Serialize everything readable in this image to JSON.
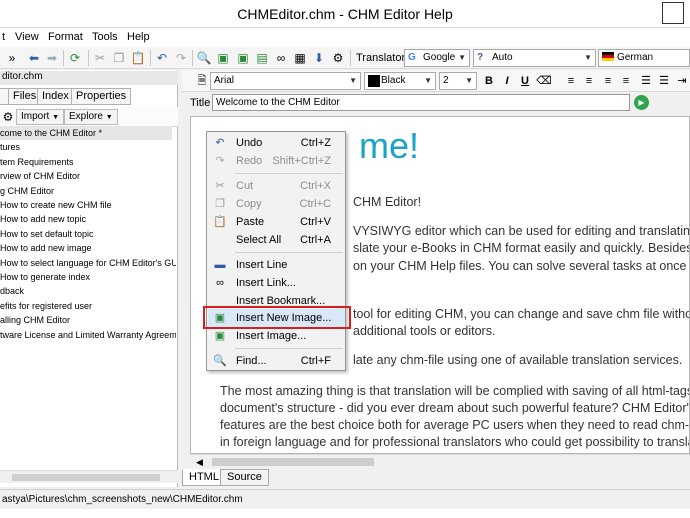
{
  "window": {
    "title": "CHMEditor.chm - CHM Editor Help"
  },
  "menu": [
    "t",
    "View",
    "Format",
    "Tools",
    "Help"
  ],
  "toolbar": {
    "translator_label": "Translator",
    "engine": "Google",
    "source_lang": "Auto",
    "target_lang": "German"
  },
  "left_pane": {
    "file_name": "ditor.chm",
    "tabs": [
      "Files",
      "Index",
      "Properties"
    ],
    "import_label": "Import",
    "explore_label": "Explore",
    "items": [
      "come to the CHM Editor *",
      "tures",
      "tem Requirements",
      "rview of CHM Editor",
      "g CHM Editor",
      "How to create new CHM file",
      "How to add new topic",
      "How to set default topic",
      "How to add new image",
      "How to select language for CHM Editor's GUI",
      "How to generate index",
      "dback",
      "efits for registered user",
      "alling CHM Editor",
      "tware License and Limited Warranty Agreeme"
    ]
  },
  "format_bar": {
    "font": "Arial",
    "color": "Black",
    "size": "2"
  },
  "editor": {
    "title_label": "Title",
    "title_value": "Welcome to the CHM Editor",
    "heading": "me!",
    "lines": [
      "CHM Editor!",
      "VYSIWYG editor which can be used for editing and translating",
      "slate your e-Books in CHM format easily and quickly. Besides, this",
      "on your CHM Help files. You can solve several tasks at once by",
      "tool for editing CHM, you can change and save chm file without",
      "additional tools or editors.",
      "late any chm-file using one of available translation services.",
      "The most amazing thing is that translation will be complied with saving of all html-tags and",
      "document's structure - did you ever dream about such powerful feature? CHM Editor's",
      "features are the best choice both for average PC users when they need to read chm-help",
      "in foreign language and for professional translators who could get possibility to translate"
    ],
    "tabs": [
      "HTML",
      "Source"
    ]
  },
  "status": {
    "path": "astya\\Pictures\\chm_screenshots_new\\CHMEditor.chm"
  },
  "context_menu": {
    "items": [
      {
        "label": "Undo",
        "key": "Ctrl+Z",
        "icon": "undo-icon",
        "enabled": true
      },
      {
        "label": "Redo",
        "key": "Shift+Ctrl+Z",
        "icon": "redo-icon",
        "enabled": false
      },
      {
        "label": "Cut",
        "key": "Ctrl+X",
        "icon": "cut-icon",
        "enabled": false
      },
      {
        "label": "Copy",
        "key": "Ctrl+C",
        "icon": "copy-icon",
        "enabled": false
      },
      {
        "label": "Paste",
        "key": "Ctrl+V",
        "icon": "paste-icon",
        "enabled": true
      },
      {
        "label": "Select All",
        "key": "Ctrl+A",
        "icon": "",
        "enabled": true
      },
      {
        "label": "Insert Line",
        "key": "",
        "icon": "line-icon",
        "enabled": true
      },
      {
        "label": "Insert Link...",
        "key": "",
        "icon": "link-icon",
        "enabled": true
      },
      {
        "label": "Insert Bookmark...",
        "key": "",
        "icon": "bookmark-icon",
        "enabled": true
      },
      {
        "label": "Insert New Image...",
        "key": "",
        "icon": "new-image-icon",
        "enabled": true
      },
      {
        "label": "Insert Image...",
        "key": "",
        "icon": "image-icon",
        "enabled": true
      },
      {
        "label": "Find...",
        "key": "Ctrl+F",
        "icon": "find-icon",
        "enabled": true
      }
    ]
  },
  "colors": {
    "heading": "#1ba3c6",
    "highlight_box": "#d61f1f",
    "menu_highlight": "#d9e8f7"
  }
}
